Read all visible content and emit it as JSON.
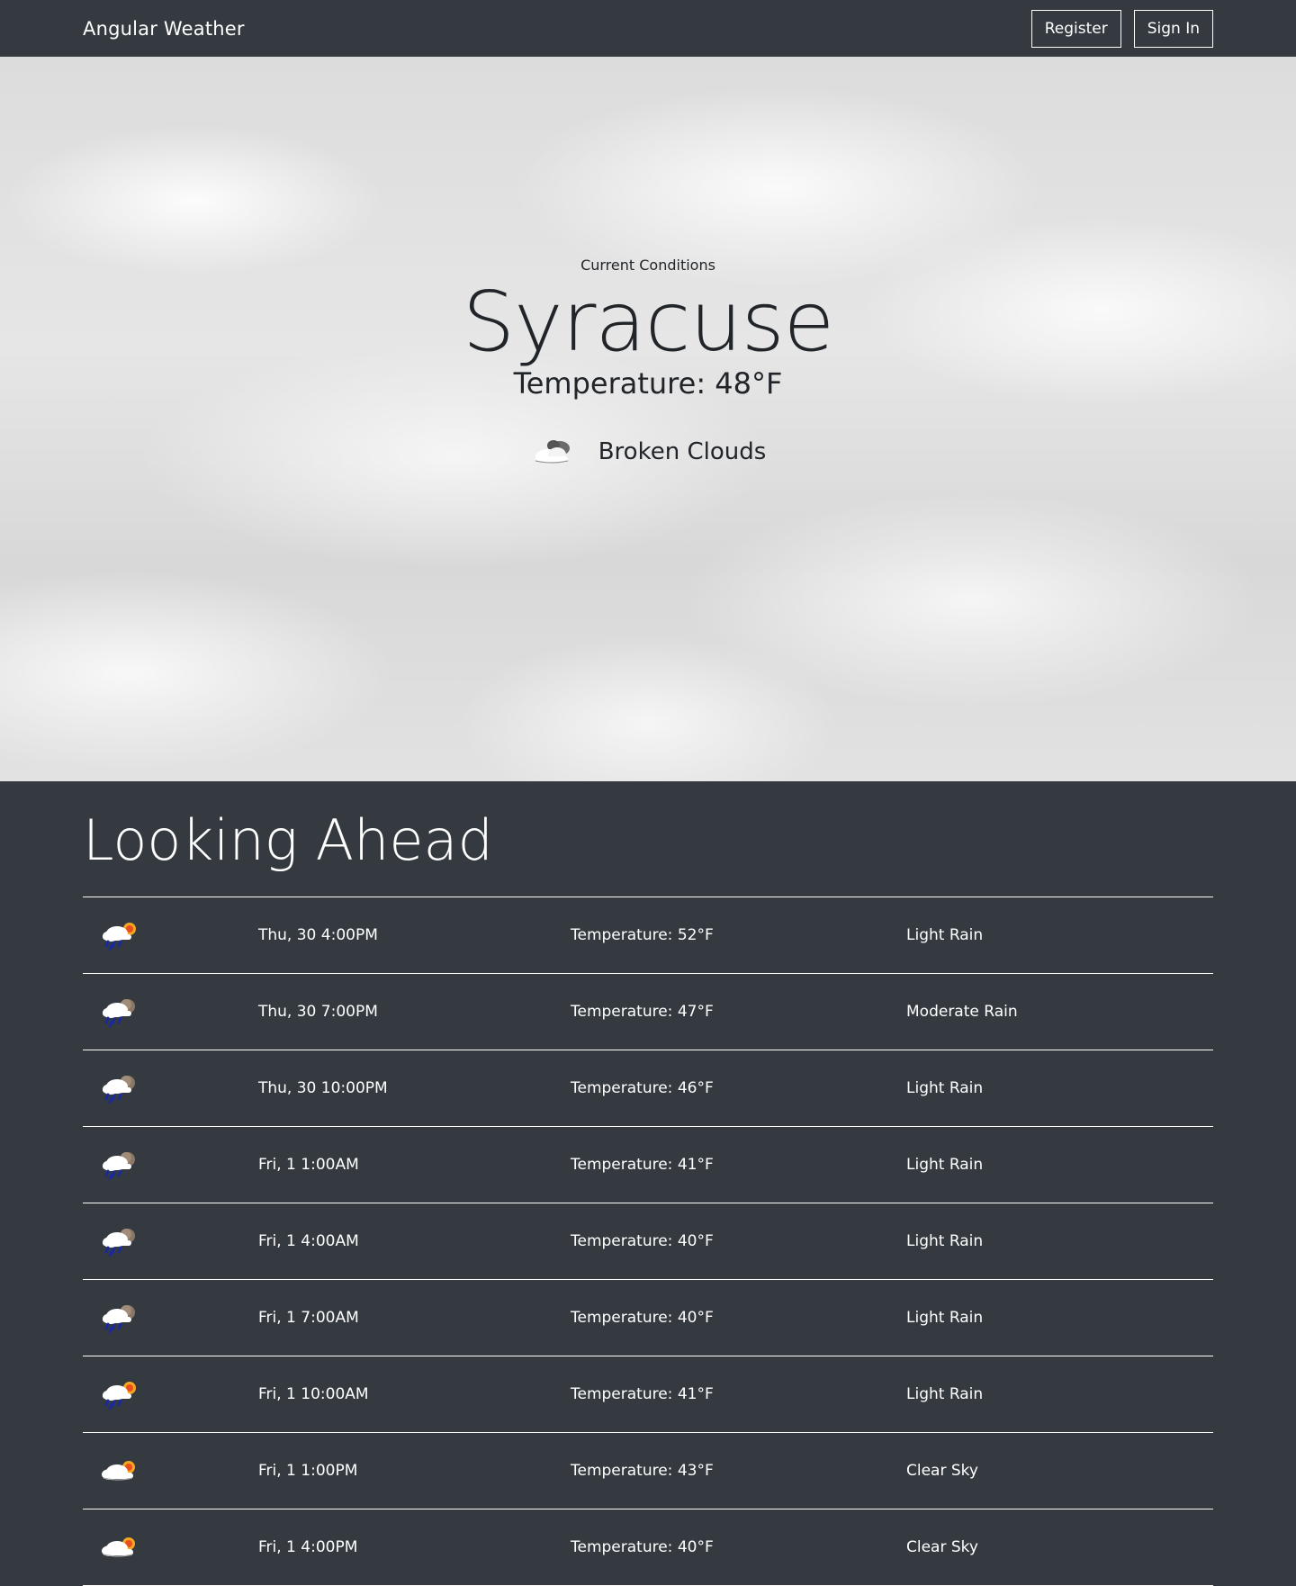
{
  "navbar": {
    "brand": "Angular Weather",
    "register_label": "Register",
    "signin_label": "Sign In"
  },
  "hero": {
    "label": "Current Conditions",
    "city": "Syracuse",
    "temperature": "Temperature: 48°F",
    "condition": "Broken Clouds",
    "condition_icon": "broken-clouds-icon"
  },
  "forecast": {
    "title": "Looking Ahead",
    "rows": [
      {
        "icon": "rain-sun-icon",
        "time": "Thu, 30 4:00PM",
        "temp": "Temperature: 52°F",
        "desc": "Light Rain"
      },
      {
        "icon": "rain-moon-icon",
        "time": "Thu, 30 7:00PM",
        "temp": "Temperature: 47°F",
        "desc": "Moderate Rain"
      },
      {
        "icon": "rain-moon-icon",
        "time": "Thu, 30 10:00PM",
        "temp": "Temperature: 46°F",
        "desc": "Light Rain"
      },
      {
        "icon": "rain-moon-icon",
        "time": "Fri, 1 1:00AM",
        "temp": "Temperature: 41°F",
        "desc": "Light Rain"
      },
      {
        "icon": "rain-moon-icon",
        "time": "Fri, 1 4:00AM",
        "temp": "Temperature: 40°F",
        "desc": "Light Rain"
      },
      {
        "icon": "rain-moon-icon",
        "time": "Fri, 1 7:00AM",
        "temp": "Temperature: 40°F",
        "desc": "Light Rain"
      },
      {
        "icon": "rain-sun-icon",
        "time": "Fri, 1 10:00AM",
        "temp": "Temperature: 41°F",
        "desc": "Light Rain"
      },
      {
        "icon": "cloud-sun-icon",
        "time": "Fri, 1 1:00PM",
        "temp": "Temperature: 43°F",
        "desc": "Clear Sky"
      },
      {
        "icon": "cloud-sun-icon",
        "time": "Fri, 1 4:00PM",
        "temp": "Temperature: 40°F",
        "desc": "Clear Sky"
      }
    ]
  },
  "colors": {
    "dark_bg": "#343a40",
    "hero_text": "#212529",
    "rain_drop": "#1a2a9c",
    "sun": "#f5a623",
    "moon": "#8b7765"
  }
}
